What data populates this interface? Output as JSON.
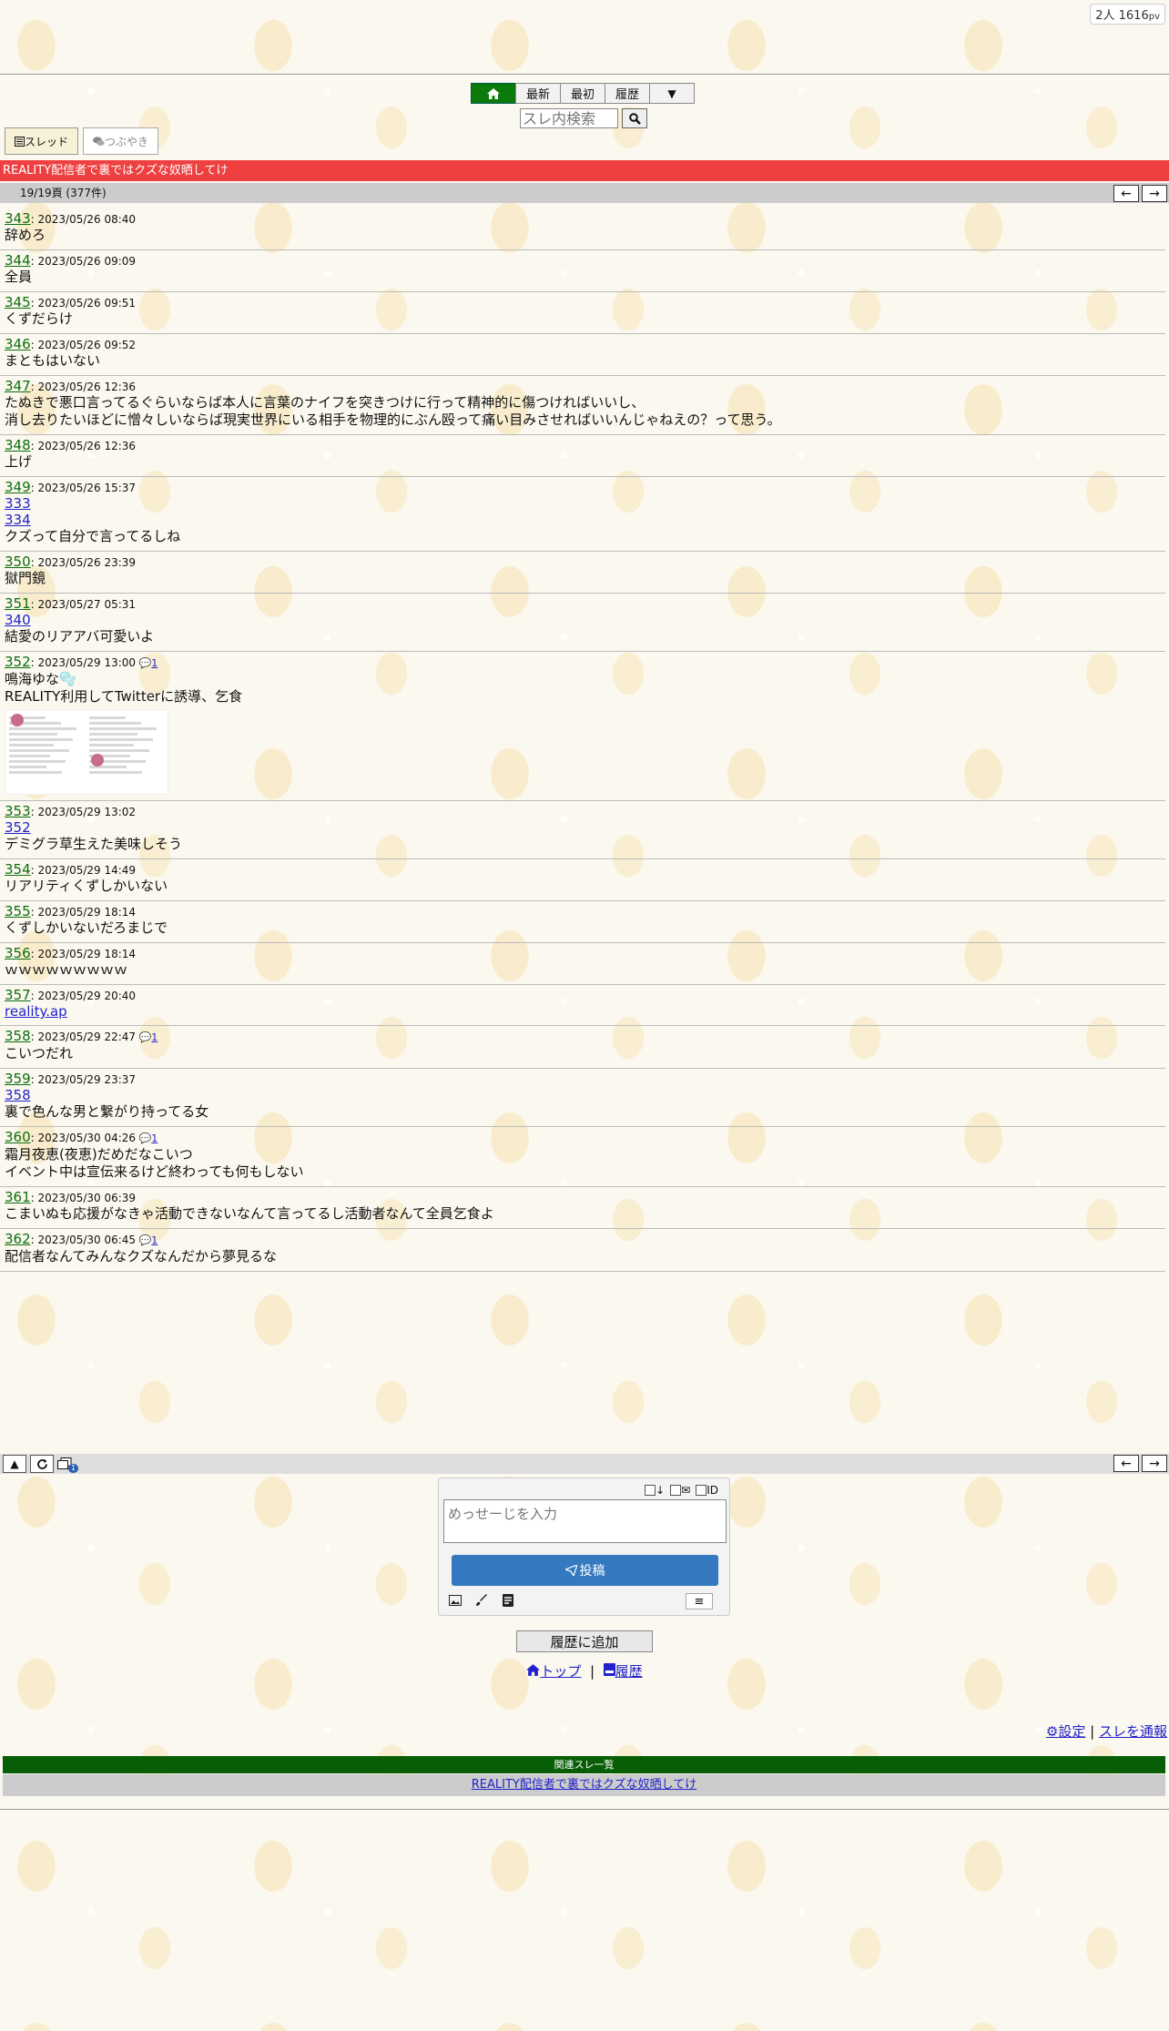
{
  "counter": {
    "people": "2人",
    "pv_value": "1616",
    "pv_unit": "pv"
  },
  "nav": {
    "home_icon": "home-icon",
    "latest": "最新",
    "first": "最初",
    "history": "履歴",
    "more": "▼"
  },
  "search": {
    "placeholder": "スレ内検索"
  },
  "tabs": {
    "thread": "スレッド",
    "tweet": "つぶやき"
  },
  "thread_title": "REALITY配信者で裏ではクズな奴晒してけ",
  "pagination": {
    "info": "19/19頁 (377件)"
  },
  "posts": [
    {
      "num": "343",
      "date": "2023/05/26 08:40",
      "lines": [
        "辞めろ"
      ]
    },
    {
      "num": "344",
      "date": "2023/05/26 09:09",
      "lines": [
        "全員"
      ]
    },
    {
      "num": "345",
      "date": "2023/05/26 09:51",
      "lines": [
        "くずだらけ"
      ]
    },
    {
      "num": "346",
      "date": "2023/05/26 09:52",
      "lines": [
        "まともはいない"
      ]
    },
    {
      "num": "347",
      "date": "2023/05/26 12:36",
      "lines": [
        "たぬきで悪口言ってるぐらいならば本人に言葉のナイフを突きつけに行って精神的に傷つければいいし、",
        "消し去りたいほどに憎々しいならば現実世界にいる相手を物理的にぶん殴って痛い目みさせればいいんじゃねえの？って思う。"
      ]
    },
    {
      "num": "348",
      "date": "2023/05/26 12:36",
      "lines": [
        "上げ"
      ]
    },
    {
      "num": "349",
      "date": "2023/05/26 15:37",
      "refs": [
        "333",
        "334"
      ],
      "lines": [
        "クズって自分で言ってるしね"
      ]
    },
    {
      "num": "350",
      "date": "2023/05/26 23:39",
      "lines": [
        "獄門鏡"
      ]
    },
    {
      "num": "351",
      "date": "2023/05/27 05:31",
      "refs": [
        "340"
      ],
      "lines": [
        "結愛のリアアバ可愛いよ"
      ]
    },
    {
      "num": "352",
      "date": "2023/05/29 13:00",
      "reply": "1",
      "lines": [
        "鳴海ゆな🫧",
        "REALITY利用してTwitterに誘導、乞食"
      ],
      "image": true
    },
    {
      "num": "353",
      "date": "2023/05/29 13:02",
      "refs": [
        "352"
      ],
      "lines": [
        "デミグラ草生えた美味しそう"
      ]
    },
    {
      "num": "354",
      "date": "2023/05/29 14:49",
      "lines": [
        "リアリティくずしかいない"
      ]
    },
    {
      "num": "355",
      "date": "2023/05/29 18:14",
      "lines": [
        "くずしかいないだろまじで"
      ]
    },
    {
      "num": "356",
      "date": "2023/05/29 18:14",
      "lines": [
        "ｗｗｗｗｗｗｗｗｗ"
      ]
    },
    {
      "num": "357",
      "date": "2023/05/29 20:40",
      "links": [
        "reality.ap"
      ]
    },
    {
      "num": "358",
      "date": "2023/05/29 22:47",
      "reply": "1",
      "lines": [
        "こいつだれ"
      ]
    },
    {
      "num": "359",
      "date": "2023/05/29 23:37",
      "refs": [
        "358"
      ],
      "lines": [
        "裏で色んな男と繋がり持ってる女"
      ]
    },
    {
      "num": "360",
      "date": "2023/05/30 04:26",
      "reply": "1",
      "lines": [
        "霜月夜恵(夜恵)だめだなこいつ",
        "イベント中は宣伝来るけど終わっても何もしない"
      ]
    },
    {
      "num": "361",
      "date": "2023/05/30 06:39",
      "lines": [
        "こまいぬも応援がなきゃ活動できないなんて言ってるし活動者なんて全員乞食よ"
      ]
    },
    {
      "num": "362",
      "date": "2023/05/30 06:45",
      "reply": "1",
      "lines": [
        "配信者なんてみんなクズなんだから夢見るな"
      ]
    }
  ],
  "bottom_bar": {
    "scroll_top": "▲",
    "refresh_icon": "refresh-icon",
    "badge": "1"
  },
  "form": {
    "placeholder": "めっせーじを入力",
    "opt_id": "ID",
    "submit": "投稿",
    "menu": "≡"
  },
  "add_history": "履歴に追加",
  "footer": {
    "top": "トップ",
    "separator": "|",
    "history": "履歴"
  },
  "right_links": {
    "settings": "設定",
    "separator": "|",
    "report": "スレを通報"
  },
  "related": {
    "heading": "関連スレ一覧",
    "link": "REALITY配信者で裏ではクズな奴晒してけ"
  },
  "colors": {
    "title_bar": "#ee4040",
    "home_button": "#0b7a0b",
    "post_number": "#0b6e0b",
    "submit_button": "#3579c0",
    "related_heading": "#075e07"
  }
}
